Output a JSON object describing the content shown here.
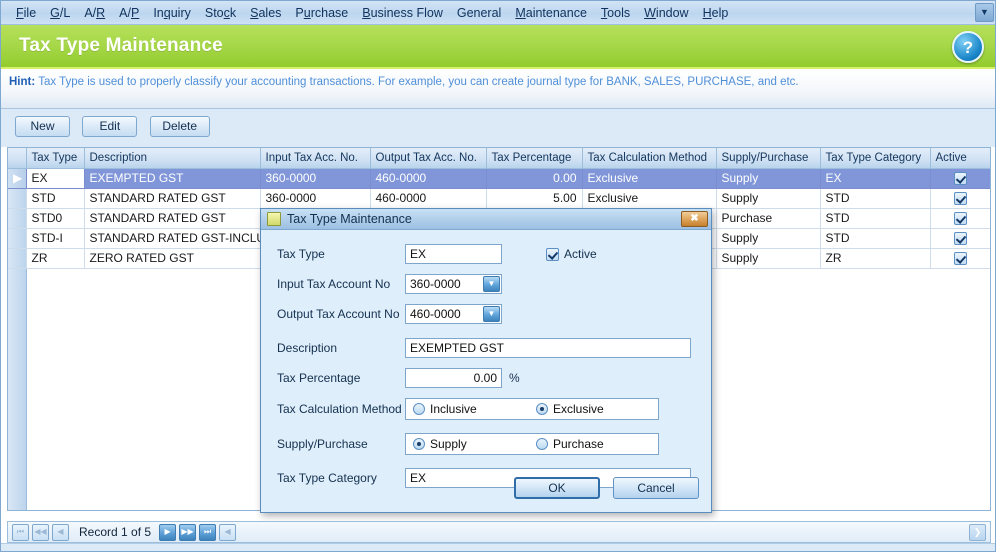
{
  "menu": {
    "items": [
      {
        "label": "File",
        "accel": "F"
      },
      {
        "label": "G/L",
        "accel": "G"
      },
      {
        "label": "A/R",
        "accel": "R"
      },
      {
        "label": "A/P",
        "accel": "P"
      },
      {
        "label": "Inquiry",
        "accel": "q"
      },
      {
        "label": "Stock",
        "accel": "c"
      },
      {
        "label": "Sales",
        "accel": "S"
      },
      {
        "label": "Purchase",
        "accel": "u"
      },
      {
        "label": "Business Flow",
        "accel": "B"
      },
      {
        "label": "General",
        "accel": ""
      },
      {
        "label": "Maintenance",
        "accel": "M"
      },
      {
        "label": "Tools",
        "accel": "T"
      },
      {
        "label": "Window",
        "accel": "W"
      },
      {
        "label": "Help",
        "accel": "H"
      }
    ],
    "overflow_icon": "chevron-down-icon"
  },
  "header": {
    "title": "Tax Type Maintenance",
    "help_icon": "question-mark-icon",
    "help_glyph": "?",
    "band_color": "#a7d84a"
  },
  "hint": {
    "label": "Hint:",
    "text": "Tax Type is used to properly classify your accounting transactions. For example, you can create journal type for BANK, SALES, PURCHASE, and etc."
  },
  "toolbar": {
    "new_label": "New",
    "edit_label": "Edit",
    "delete_label": "Delete"
  },
  "grid": {
    "columns": [
      "Tax Type",
      "Description",
      "Input Tax Acc. No.",
      "Output Tax Acc. No.",
      "Tax Percentage",
      "Tax Calculation Method",
      "Supply/Purchase",
      "Tax Type Category",
      "Active"
    ],
    "rows": [
      {
        "tax_type": "EX",
        "description": "EXEMPTED GST",
        "input_acc": "360-0000",
        "output_acc": "460-0000",
        "percentage": "0.00",
        "method": "Exclusive",
        "supply_purchase": "Supply",
        "category": "EX",
        "active": true,
        "selected": true,
        "indicator": "▶"
      },
      {
        "tax_type": "STD",
        "description": "STANDARD RATED GST",
        "input_acc": "360-0000",
        "output_acc": "460-0000",
        "percentage": "5.00",
        "method": "Exclusive",
        "supply_purchase": "Supply",
        "category": "STD",
        "active": true,
        "selected": false,
        "indicator": ""
      },
      {
        "tax_type": "STD0",
        "description": "STANDARD RATED GST",
        "input_acc": "",
        "output_acc": "",
        "percentage": "",
        "method": "",
        "supply_purchase": "Purchase",
        "category": "STD",
        "active": true,
        "selected": false,
        "indicator": ""
      },
      {
        "tax_type": "STD-I",
        "description": "STANDARD RATED GST-INCLUSIVE",
        "input_acc": "",
        "output_acc": "",
        "percentage": "",
        "method": "",
        "supply_purchase": "Supply",
        "category": "STD",
        "active": true,
        "selected": false,
        "indicator": ""
      },
      {
        "tax_type": "ZR",
        "description": "ZERO RATED GST",
        "input_acc": "",
        "output_acc": "",
        "percentage": "",
        "method": "",
        "supply_purchase": "Supply",
        "category": "ZR",
        "active": true,
        "selected": false,
        "indicator": ""
      }
    ]
  },
  "dialog": {
    "title": "Tax Type Maintenance",
    "icon": "document-icon",
    "close_glyph": "✖",
    "fields": {
      "tax_type_label": "Tax Type",
      "tax_type_value": "EX",
      "input_acc_label": "Input Tax Account No",
      "input_acc_value": "360-0000",
      "output_acc_label": "Output Tax Account No",
      "output_acc_value": "460-0000",
      "description_label": "Description",
      "description_value": "EXEMPTED GST",
      "percentage_label": "Tax Percentage",
      "percentage_value": "0.00",
      "percent_sign": "%",
      "method_label": "Tax Calculation Method",
      "method_option_1": "Inclusive",
      "method_option_2": "Exclusive",
      "method_selected": "Exclusive",
      "supply_label": "Supply/Purchase",
      "supply_option_1": "Supply",
      "supply_option_2": "Purchase",
      "supply_selected": "Supply",
      "category_label": "Tax Type Category",
      "category_value": "EX",
      "active_label": "Active",
      "active_checked": true
    },
    "buttons": {
      "ok_label": "OK",
      "cancel_label": "Cancel"
    }
  },
  "navigator": {
    "first_glyph": "⏮",
    "prev_page_glyph": "◀◀",
    "prev_glyph": "◀",
    "record_label": "Record 1 of 5",
    "next_glyph": "▶",
    "next_page_glyph": "▶▶",
    "last_glyph": "⏭",
    "close_glyph": "◀",
    "right_glyph": "❯"
  }
}
